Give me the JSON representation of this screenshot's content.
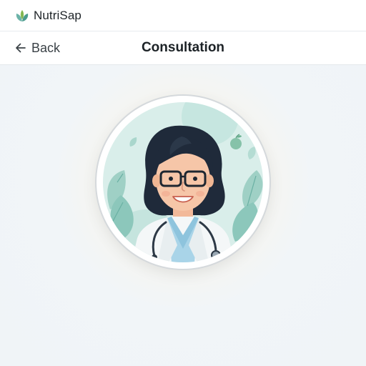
{
  "app": {
    "name": "NutriSap",
    "logo_icon": "leaf-logo-icon"
  },
  "navbar": {
    "back_label": "Back",
    "back_icon": "arrow-left-icon",
    "title": "Consultation"
  },
  "consultant": {
    "avatar_icon": "doctor-avatar-illustration"
  },
  "colors": {
    "brand_green": "#5aa85a",
    "brand_teal": "#6fc2b5",
    "avatar_background": "#cfe8e4",
    "page_background": "#f1f5f8"
  }
}
